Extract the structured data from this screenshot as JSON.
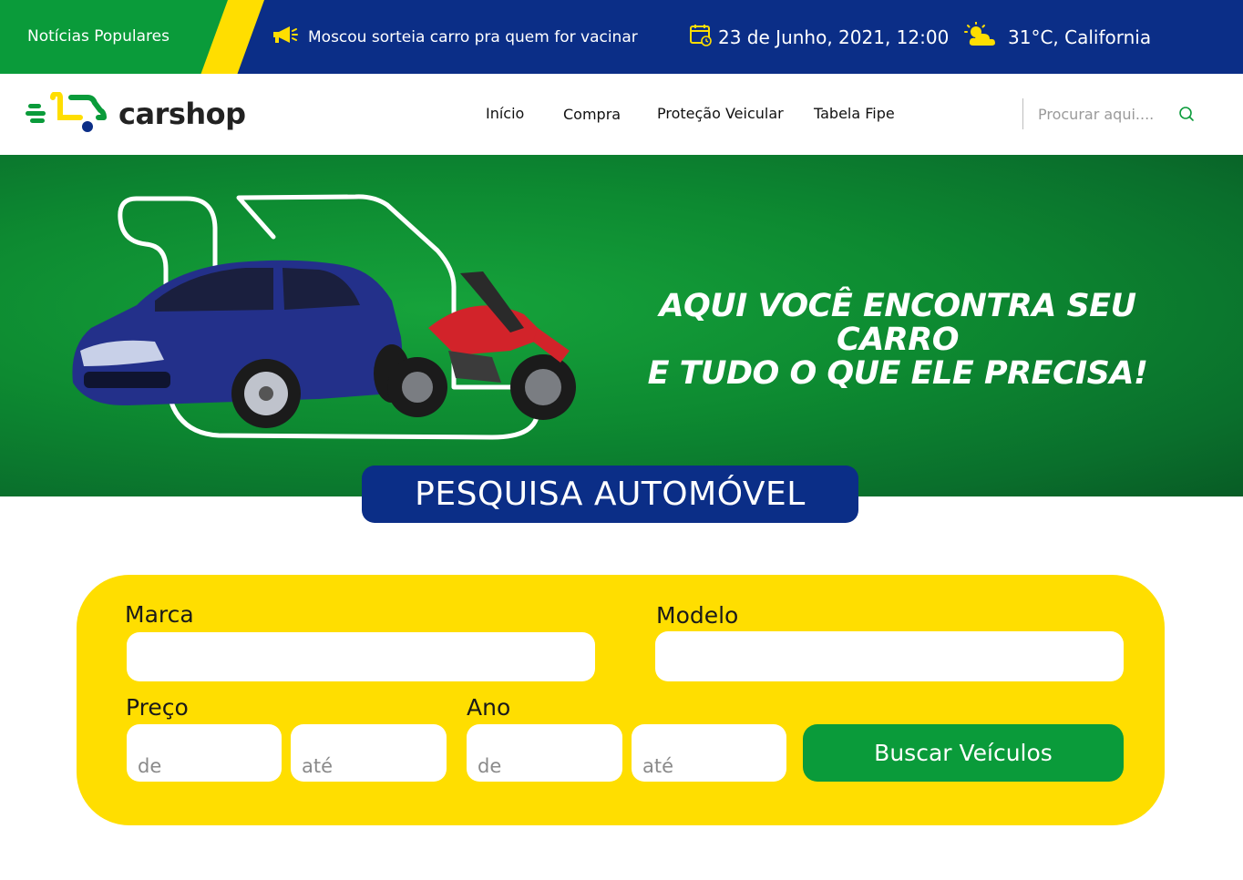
{
  "topbar": {
    "popular_label": "Notícias Populares",
    "news_headline": "Moscou sorteia carro pra quem for vacinar",
    "datetime": "23 de Junho, 2021, 12:00",
    "weather": "31°C, California",
    "icons": {
      "news": "megaphone-icon",
      "date": "calendar-icon",
      "weather": "sun-cloud-icon"
    }
  },
  "header": {
    "brand": "carshop",
    "nav": [
      "Início",
      "Compra",
      "Proteção Veicular",
      "Tabela Fipe"
    ],
    "search_placeholder": "Procurar aqui....",
    "search_icon": "search-icon"
  },
  "hero": {
    "tagline_line1": "AQUI VOCÊ ENCONTRA SEU CARRO",
    "tagline_line2": "E TUDO O QUE ELE PRECISA!"
  },
  "search_section": {
    "title": "PESQUISA AUTOMÓVEL",
    "marca_label": "Marca",
    "modelo_label": "Modelo",
    "preco_label": "Preço",
    "ano_label": "Ano",
    "from_placeholder": "de",
    "to_placeholder": "até",
    "button_label": "Buscar Veículos"
  },
  "colors": {
    "brand_blue": "#0b2e87",
    "brand_green": "#0a9b3a",
    "brand_yellow": "#ffde00"
  }
}
